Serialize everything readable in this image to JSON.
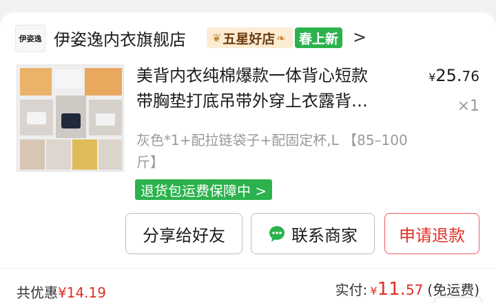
{
  "shop": {
    "logo_text": "伊姿逸",
    "name": "伊姿逸内衣旗舰店",
    "badge_rating": "五星好店",
    "badge_new": "春上新",
    "chevron": ">"
  },
  "product": {
    "image_icon": "product-collage-image",
    "title_line1": "美背内衣纯棉爆款一体背心短款",
    "title_line2": "带胸垫打底吊带外穿上衣露背…",
    "price_currency": "¥",
    "price_int": "25.",
    "price_dec": "76",
    "quantity": "×1",
    "spec": "灰色*1+配拉链袋子+配固定杯,L 【85–100斤】",
    "guarantee": "退货包运费保障中 >"
  },
  "actions": {
    "share": "分享给好友",
    "contact": "联系商家",
    "contact_icon": "chat-bubble-icon",
    "refund": "申请退款"
  },
  "summary": {
    "discount_label": "共优惠",
    "discount_amount": "¥14.19",
    "paid_label": "实付:",
    "paid_currency": "¥",
    "paid_int": "11.",
    "paid_dec": "57",
    "paid_note": "(免运费)"
  },
  "colors": {
    "accent_red": "#e02e24",
    "accent_green": "#2bb24c",
    "badge_bg": "#fbecd3"
  }
}
